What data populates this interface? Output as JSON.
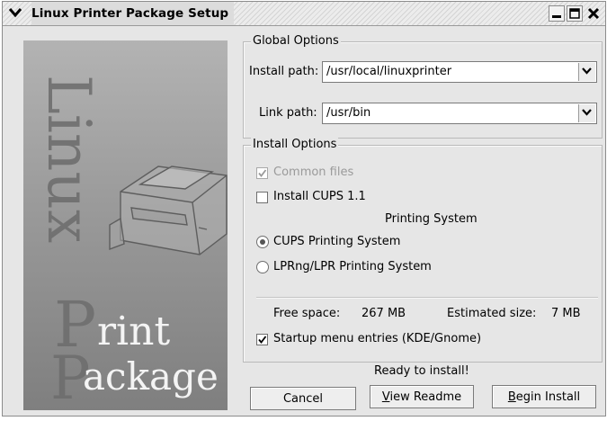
{
  "window": {
    "title": "Linux Printer Package Setup"
  },
  "banner": {
    "word_linux": "Linux",
    "letter_p": "P",
    "word_rint": "rint",
    "letter_p2": "P",
    "word_ackage": "ackage"
  },
  "global_options": {
    "legend": "Global Options",
    "install_path_label": "Install path:",
    "install_path_value": "/usr/local/linuxprinter",
    "link_path_label": "Link path:",
    "link_path_value": "/usr/bin"
  },
  "install_options": {
    "legend": "Install Options",
    "common_files_label": "Common files",
    "common_files_checked": true,
    "install_cups_label": "Install CUPS 1.1",
    "install_cups_checked": false,
    "printing_system_label": "Printing System",
    "radio_cups_label": "CUPS Printing System",
    "radio_lprng_label": "LPRng/LPR Printing System",
    "selected_system": "CUPS Printing System",
    "free_space_label": "Free space:",
    "free_space_value": "267 MB",
    "estimated_size_label": "Estimated size:",
    "estimated_size_value": "7 MB",
    "startup_menu_label": "Startup menu entries (KDE/Gnome)",
    "startup_menu_checked": true
  },
  "status": {
    "text": "Ready to install!"
  },
  "buttons": {
    "cancel": "Cancel",
    "view_readme_mnemonic": "V",
    "view_readme_rest": "iew Readme",
    "begin_install_mnemonic": "B",
    "begin_install_rest": "egin Install"
  },
  "icons": {
    "menu": "chevron-down-icon",
    "minimize": "minimize-icon",
    "maximize": "maximize-icon",
    "close": "close-icon",
    "printer": "printer-illustration"
  },
  "colors": {
    "window_bg": "#e6e6e6",
    "banner_dark": "#7f7f7f",
    "banner_light": "#b3b3b3"
  }
}
